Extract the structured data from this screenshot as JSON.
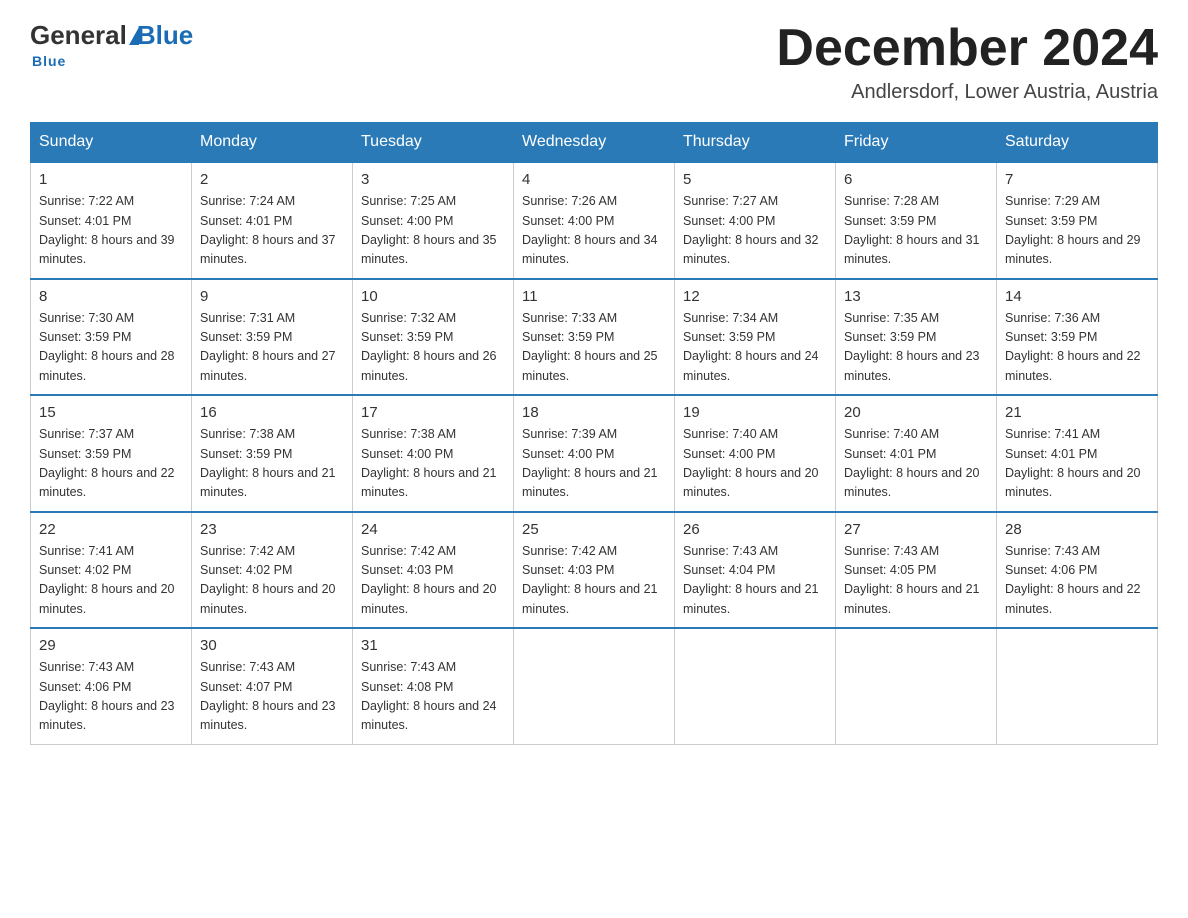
{
  "header": {
    "logo_general": "General",
    "logo_triangle": "▲",
    "logo_blue": "Blue",
    "month_title": "December 2024",
    "location": "Andlersdorf, Lower Austria, Austria"
  },
  "days_of_week": [
    "Sunday",
    "Monday",
    "Tuesday",
    "Wednesday",
    "Thursday",
    "Friday",
    "Saturday"
  ],
  "weeks": [
    [
      {
        "num": "1",
        "sunrise": "7:22 AM",
        "sunset": "4:01 PM",
        "daylight": "8 hours and 39 minutes."
      },
      {
        "num": "2",
        "sunrise": "7:24 AM",
        "sunset": "4:01 PM",
        "daylight": "8 hours and 37 minutes."
      },
      {
        "num": "3",
        "sunrise": "7:25 AM",
        "sunset": "4:00 PM",
        "daylight": "8 hours and 35 minutes."
      },
      {
        "num": "4",
        "sunrise": "7:26 AM",
        "sunset": "4:00 PM",
        "daylight": "8 hours and 34 minutes."
      },
      {
        "num": "5",
        "sunrise": "7:27 AM",
        "sunset": "4:00 PM",
        "daylight": "8 hours and 32 minutes."
      },
      {
        "num": "6",
        "sunrise": "7:28 AM",
        "sunset": "3:59 PM",
        "daylight": "8 hours and 31 minutes."
      },
      {
        "num": "7",
        "sunrise": "7:29 AM",
        "sunset": "3:59 PM",
        "daylight": "8 hours and 29 minutes."
      }
    ],
    [
      {
        "num": "8",
        "sunrise": "7:30 AM",
        "sunset": "3:59 PM",
        "daylight": "8 hours and 28 minutes."
      },
      {
        "num": "9",
        "sunrise": "7:31 AM",
        "sunset": "3:59 PM",
        "daylight": "8 hours and 27 minutes."
      },
      {
        "num": "10",
        "sunrise": "7:32 AM",
        "sunset": "3:59 PM",
        "daylight": "8 hours and 26 minutes."
      },
      {
        "num": "11",
        "sunrise": "7:33 AM",
        "sunset": "3:59 PM",
        "daylight": "8 hours and 25 minutes."
      },
      {
        "num": "12",
        "sunrise": "7:34 AM",
        "sunset": "3:59 PM",
        "daylight": "8 hours and 24 minutes."
      },
      {
        "num": "13",
        "sunrise": "7:35 AM",
        "sunset": "3:59 PM",
        "daylight": "8 hours and 23 minutes."
      },
      {
        "num": "14",
        "sunrise": "7:36 AM",
        "sunset": "3:59 PM",
        "daylight": "8 hours and 22 minutes."
      }
    ],
    [
      {
        "num": "15",
        "sunrise": "7:37 AM",
        "sunset": "3:59 PM",
        "daylight": "8 hours and 22 minutes."
      },
      {
        "num": "16",
        "sunrise": "7:38 AM",
        "sunset": "3:59 PM",
        "daylight": "8 hours and 21 minutes."
      },
      {
        "num": "17",
        "sunrise": "7:38 AM",
        "sunset": "4:00 PM",
        "daylight": "8 hours and 21 minutes."
      },
      {
        "num": "18",
        "sunrise": "7:39 AM",
        "sunset": "4:00 PM",
        "daylight": "8 hours and 21 minutes."
      },
      {
        "num": "19",
        "sunrise": "7:40 AM",
        "sunset": "4:00 PM",
        "daylight": "8 hours and 20 minutes."
      },
      {
        "num": "20",
        "sunrise": "7:40 AM",
        "sunset": "4:01 PM",
        "daylight": "8 hours and 20 minutes."
      },
      {
        "num": "21",
        "sunrise": "7:41 AM",
        "sunset": "4:01 PM",
        "daylight": "8 hours and 20 minutes."
      }
    ],
    [
      {
        "num": "22",
        "sunrise": "7:41 AM",
        "sunset": "4:02 PM",
        "daylight": "8 hours and 20 minutes."
      },
      {
        "num": "23",
        "sunrise": "7:42 AM",
        "sunset": "4:02 PM",
        "daylight": "8 hours and 20 minutes."
      },
      {
        "num": "24",
        "sunrise": "7:42 AM",
        "sunset": "4:03 PM",
        "daylight": "8 hours and 20 minutes."
      },
      {
        "num": "25",
        "sunrise": "7:42 AM",
        "sunset": "4:03 PM",
        "daylight": "8 hours and 21 minutes."
      },
      {
        "num": "26",
        "sunrise": "7:43 AM",
        "sunset": "4:04 PM",
        "daylight": "8 hours and 21 minutes."
      },
      {
        "num": "27",
        "sunrise": "7:43 AM",
        "sunset": "4:05 PM",
        "daylight": "8 hours and 21 minutes."
      },
      {
        "num": "28",
        "sunrise": "7:43 AM",
        "sunset": "4:06 PM",
        "daylight": "8 hours and 22 minutes."
      }
    ],
    [
      {
        "num": "29",
        "sunrise": "7:43 AM",
        "sunset": "4:06 PM",
        "daylight": "8 hours and 23 minutes."
      },
      {
        "num": "30",
        "sunrise": "7:43 AM",
        "sunset": "4:07 PM",
        "daylight": "8 hours and 23 minutes."
      },
      {
        "num": "31",
        "sunrise": "7:43 AM",
        "sunset": "4:08 PM",
        "daylight": "8 hours and 24 minutes."
      },
      null,
      null,
      null,
      null
    ]
  ]
}
